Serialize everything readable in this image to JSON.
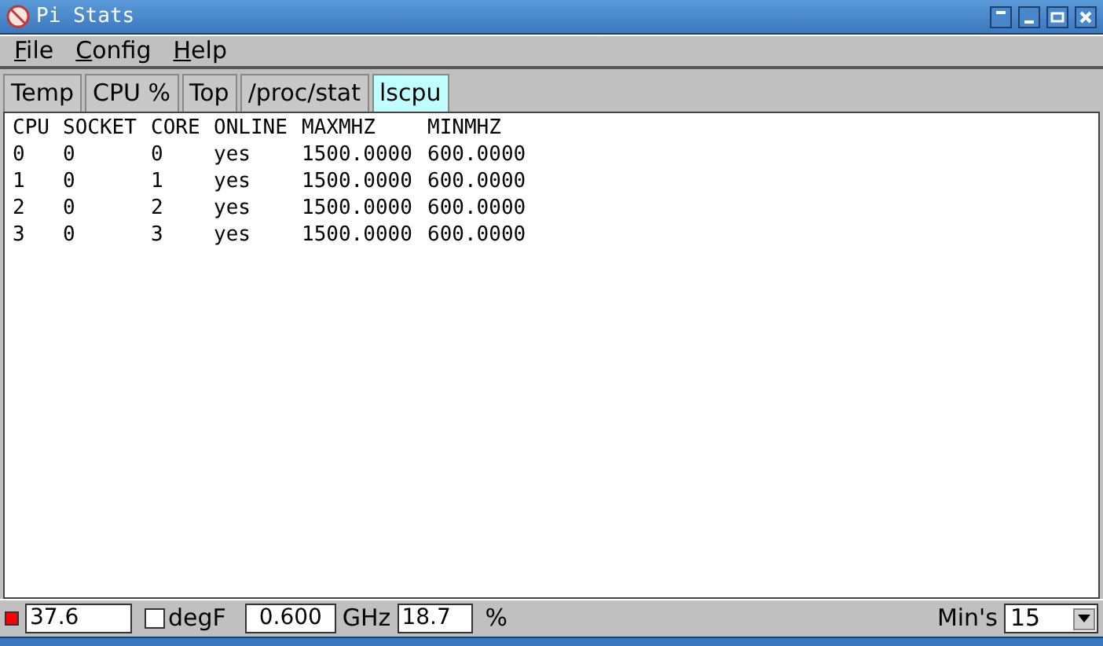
{
  "window": {
    "title": "Pi Stats"
  },
  "menu": [
    "File",
    "Config",
    "Help"
  ],
  "tabs": [
    {
      "label": "Temp",
      "selected": false
    },
    {
      "label": "CPU %",
      "selected": false
    },
    {
      "label": "Top",
      "selected": false
    },
    {
      "label": "/proc/stat",
      "selected": false
    },
    {
      "label": "lscpu",
      "selected": true
    }
  ],
  "table": {
    "columns": [
      "CPU",
      "SOCKET",
      "CORE",
      "ONLINE",
      "MAXMHZ",
      "MINMHZ"
    ],
    "rows": [
      [
        "0",
        "0",
        "0",
        "yes",
        "1500.0000",
        "600.0000"
      ],
      [
        "1",
        "0",
        "1",
        "yes",
        "1500.0000",
        "600.0000"
      ],
      [
        "2",
        "0",
        "2",
        "yes",
        "1500.0000",
        "600.0000"
      ],
      [
        "3",
        "0",
        "3",
        "yes",
        "1500.0000",
        "600.0000"
      ]
    ]
  },
  "status_bar": {
    "indicator": {
      "color": "#ff0000"
    },
    "temperature": "37.6",
    "degf": {
      "label": "degF",
      "checked": false
    },
    "frequency": "0.600",
    "frequency_unit": "GHz",
    "cpu_percent": "18.7",
    "percent_unit": "%",
    "interval_label": "Min's",
    "interval": "15"
  }
}
